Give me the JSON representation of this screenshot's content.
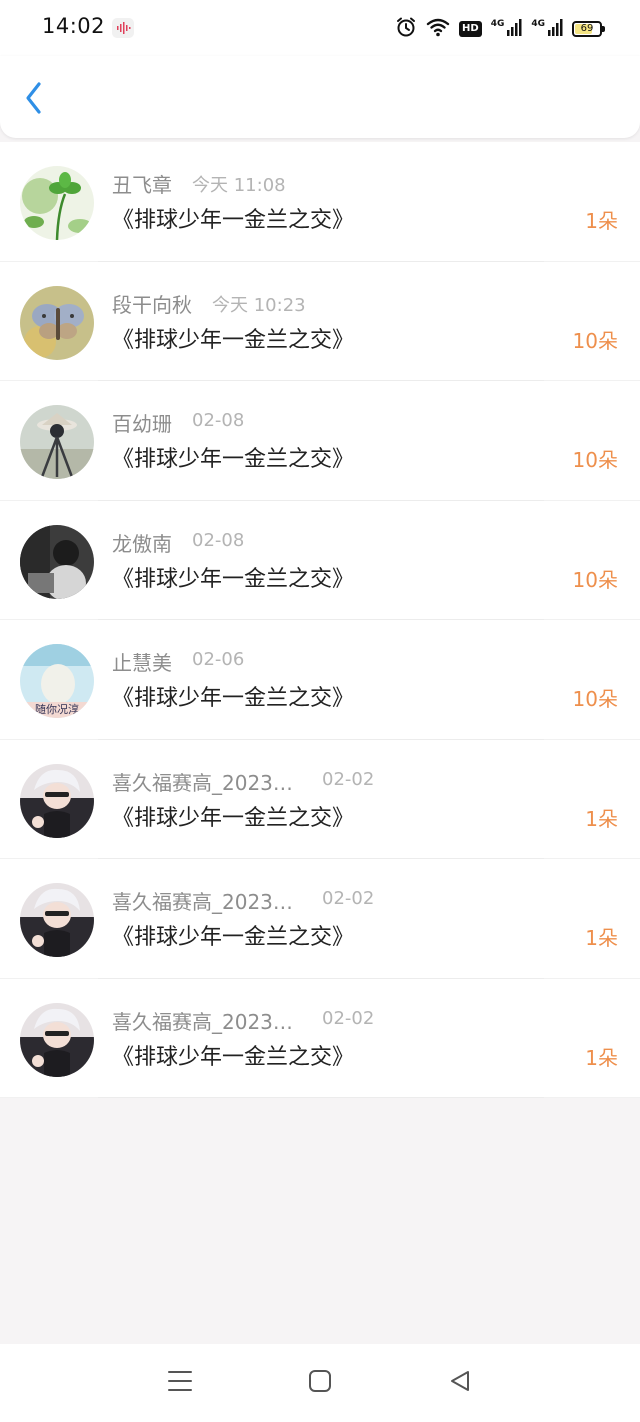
{
  "status_bar": {
    "time": "14:02",
    "icons": [
      "voice-recorder-icon",
      "alarm-clock-icon",
      "wifi-icon",
      "hd-voice-icon",
      "signal-4g-icon",
      "signal-4g-icon",
      "battery-icon"
    ],
    "hd_label": "HD",
    "network_label": "4G",
    "battery_level": "69",
    "battery_fraction": 0.69
  },
  "header": {
    "back_icon": "chevron-left-icon"
  },
  "colors": {
    "accent": "#2f8fe6",
    "count": "#ee8f4c",
    "name": "#8d8d8d",
    "time": "#b4b4b4",
    "title": "#222222"
  },
  "gift_records": [
    {
      "name": "丑飞章",
      "time": "今天 11:08",
      "title": "《排球少年一金兰之交》",
      "count": "1朵",
      "avatar": "clover"
    },
    {
      "name": "段干向秋",
      "time": "今天 10:23",
      "title": "《排球少年一金兰之交》",
      "count": "10朵",
      "avatar": "butterfly"
    },
    {
      "name": "百幼珊",
      "time": "02-08",
      "title": "《排球少年一金兰之交》",
      "count": "10朵",
      "avatar": "tripod"
    },
    {
      "name": "龙傲南",
      "time": "02-08",
      "title": "《排球少年一金兰之交》",
      "count": "10朵",
      "avatar": "monochrome"
    },
    {
      "name": "止慧美",
      "time": "02-06",
      "title": "《排球少年一金兰之交》",
      "count": "10朵",
      "avatar": "sky-text",
      "avatar_text": "随你况淳"
    },
    {
      "name": "喜久福赛高_20239...",
      "time": "02-02",
      "title": "《排球少年一金兰之交》",
      "count": "1朵",
      "avatar": "anime"
    },
    {
      "name": "喜久福赛高_20239...",
      "time": "02-02",
      "title": "《排球少年一金兰之交》",
      "count": "1朵",
      "avatar": "anime"
    },
    {
      "name": "喜久福赛高_20239...",
      "time": "02-02",
      "title": "《排球少年一金兰之交》",
      "count": "1朵",
      "avatar": "anime"
    }
  ],
  "bottom_nav": {
    "icons": [
      "menu-icon",
      "home-icon",
      "back-icon"
    ]
  }
}
